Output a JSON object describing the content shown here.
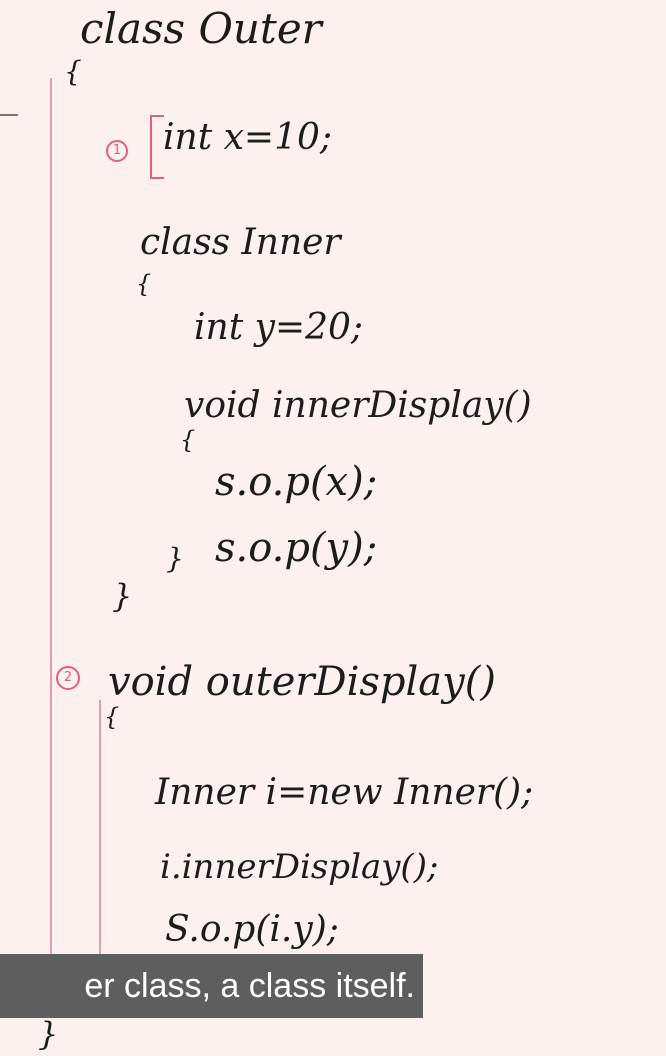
{
  "whiteboard": {
    "lines": [
      "class Outer",
      "{",
      "int x=10;",
      "class Inner",
      "{",
      "int y=20;",
      "void innerDisplay()",
      "{",
      "s.o.p(x);",
      "s.o.p(y);",
      "}",
      "}",
      "void outerDisplay()",
      "{",
      "Inner i=new Inner();",
      "i.innerDisplay();",
      "S.o.p(i.y);",
      "}",
      "}"
    ],
    "markers": [
      "1",
      "2"
    ],
    "accent_color": "#e0607e"
  },
  "subtitle": "er class, a class itself."
}
